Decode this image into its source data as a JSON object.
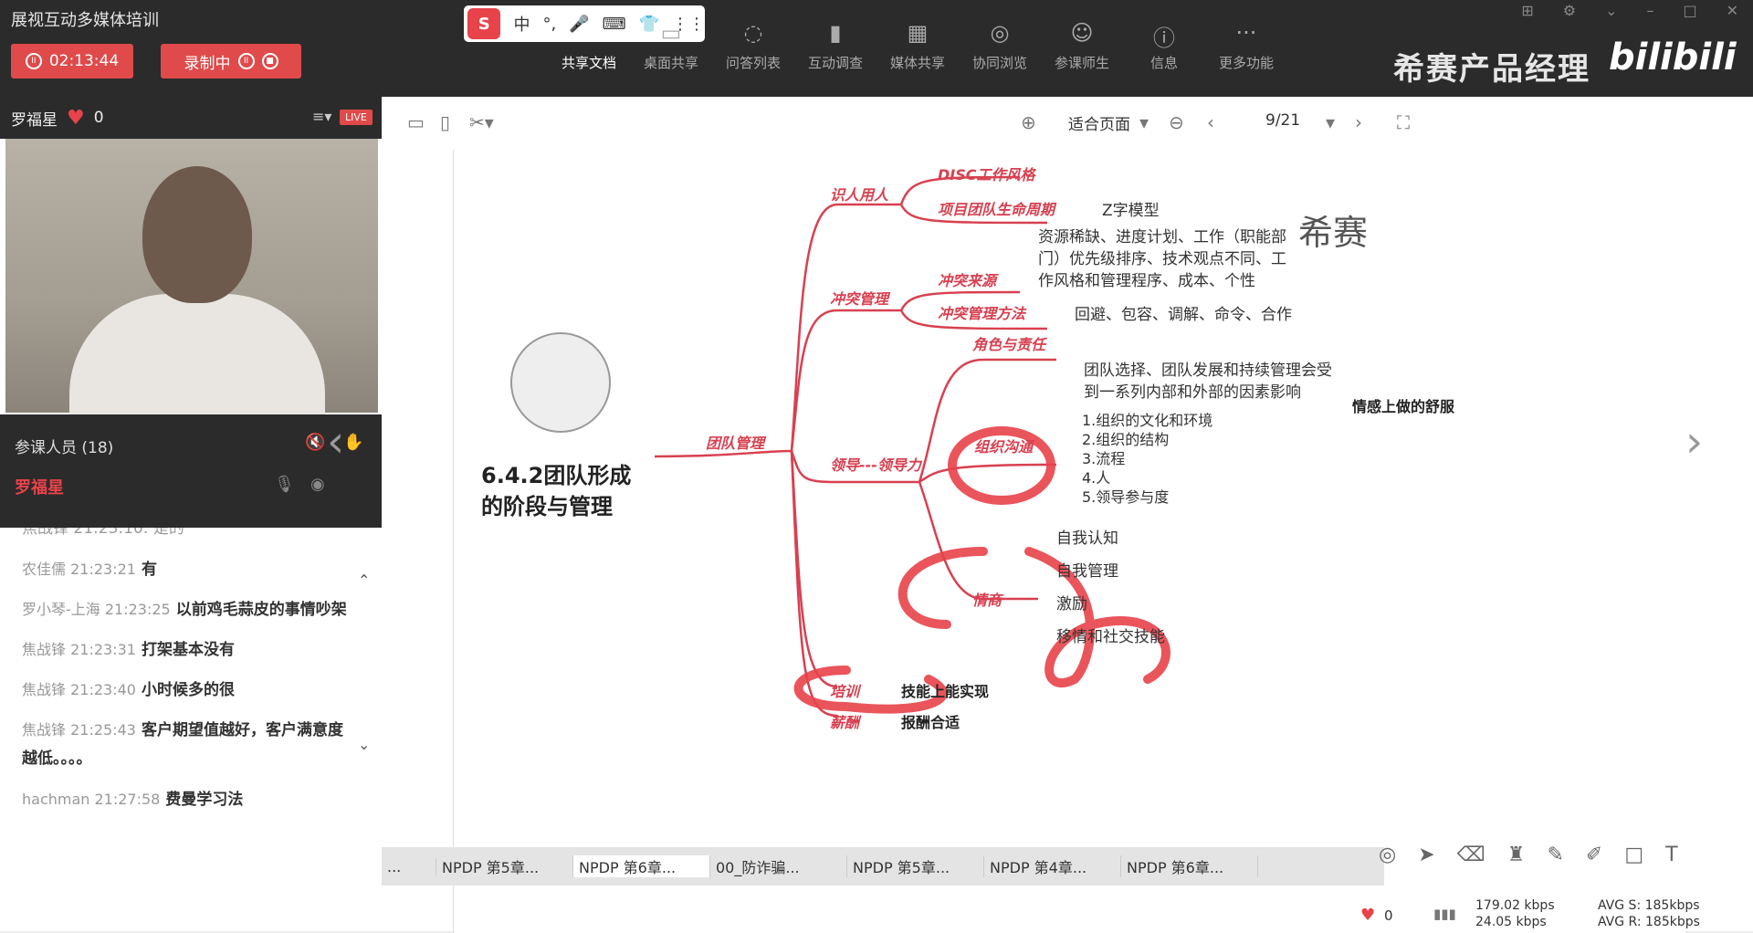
{
  "app": {
    "title": "展视互动多媒体培训"
  },
  "timer": "02:13:44",
  "recording_label": "录制中",
  "ime": {
    "logo": "S",
    "items": [
      "中",
      "°,",
      "🎤",
      "⌨",
      "👕",
      "⋮⋮"
    ]
  },
  "toolbar": [
    {
      "label": "共享文档",
      "icon": "doc-icon"
    },
    {
      "label": "桌面共享",
      "icon": "desktop-icon"
    },
    {
      "label": "问答列表",
      "icon": "qa-icon"
    },
    {
      "label": "互动调查",
      "icon": "survey-icon"
    },
    {
      "label": "媒体共享",
      "icon": "media-icon"
    },
    {
      "label": "协同浏览",
      "icon": "browse-icon"
    },
    {
      "label": "参课师生",
      "icon": "people-icon"
    },
    {
      "label": "信息",
      "icon": "info-icon"
    },
    {
      "label": "更多功能",
      "icon": "more-icon"
    }
  ],
  "brand": "希赛产品经理",
  "bili": "bilibili",
  "host": {
    "name": "罗福星",
    "likes": "0",
    "live": "LIVE"
  },
  "participants": {
    "title": "参课人员 (18)",
    "user": "罗福星"
  },
  "chat": {
    "messages": [
      {
        "who": "农佳儒 21:23:21",
        "text": "有"
      },
      {
        "who": "罗小琴-上海 21:23:25",
        "text": "以前鸡毛蒜皮的事情吵架"
      },
      {
        "who": "焦战锋 21:23:31",
        "text": "打架基本没有"
      },
      {
        "who": "焦战锋 21:23:40",
        "text": "小时候多的很"
      },
      {
        "who": "焦战锋 21:25:43",
        "text": "客户期望值越好，客户满意度越低。。。。"
      },
      {
        "who": "hachman 21:27:58",
        "text": "费曼学习法"
      }
    ],
    "partial_top": "焦战锋 21:23:10: 是的"
  },
  "doc": {
    "zoom": "适合页面",
    "page": "9/21"
  },
  "mindmap": {
    "root": "团队管理",
    "title_line1": "6.4.2团队形成",
    "title_line2": "的阶段与管理",
    "brand": "希赛",
    "b1": "识人用人",
    "b1a": "DISC工作风格",
    "b1b": "项目团队生命周期",
    "b1b_note": "Z字模型",
    "b2": "冲突管理",
    "b2a": "冲突来源",
    "b2a_note1": "资源稀缺、进度计划、工作（职能部",
    "b2a_note2": "门）优先级排序、技术观点不同、工",
    "b2a_note3": "作风格和管理程序、成本、个性",
    "b2b": "冲突管理方法",
    "b2b_note": "回避、包容、调解、命令、合作",
    "b3": "领导---领导力",
    "b3a": "角色与责任",
    "b3b_note1": "团队选择、团队发展和持续管理会受",
    "b3b_note2": "到一系列内部和外部的因素影响",
    "b3b": "组织沟通",
    "b3b_items": [
      "1.组织的文化和环境",
      "2.组织的结构",
      "3.流程",
      "4.人",
      "5.领导参与度"
    ],
    "side_note": "情感上做的舒服",
    "b3c": "情商",
    "b3c_items": [
      "自我认知",
      "自我管理",
      "激励",
      "移情和社交技能"
    ],
    "b4": "培训",
    "b4_note": "技能上能实现",
    "b5": "薪酬",
    "b5_note": "报酬合适"
  },
  "tabs": [
    "...",
    "NPDP 第5章...",
    "NPDP 第6章...",
    "00_防诈骗...",
    "NPDP 第5章...",
    "NPDP 第4章...",
    "NPDP 第6章..."
  ],
  "status": {
    "hearts": "0",
    "up": "179.02 kbps",
    "down": "24.05 kbps",
    "avg_s": "AVG S: 185kbps",
    "avg_r": "AVG R: 185kbps"
  },
  "colors": {
    "accent": "#e04a4a",
    "mindmap": "#d84050",
    "dark": "#2b2b2b"
  }
}
